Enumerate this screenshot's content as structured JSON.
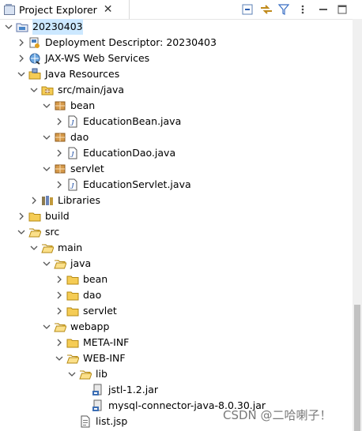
{
  "view": {
    "title": "Project Explorer",
    "close": "✕",
    "toolbar": [
      {
        "name": "collapse-all-icon"
      },
      {
        "name": "link-with-editor-icon"
      },
      {
        "name": "filter-icon"
      },
      {
        "name": "view-menu-icon"
      },
      {
        "name": "minimize-icon"
      },
      {
        "name": "maximize-icon"
      }
    ]
  },
  "tree": [
    {
      "label": "20230403",
      "depth": 0,
      "toggle": "expanded",
      "icon": "project",
      "selected": true
    },
    {
      "label": "Deployment Descriptor: 20230403",
      "depth": 1,
      "toggle": "collapsed",
      "icon": "deployment"
    },
    {
      "label": "JAX-WS Web Services",
      "depth": 1,
      "toggle": "collapsed",
      "icon": "webservice"
    },
    {
      "label": "Java Resources",
      "depth": 1,
      "toggle": "expanded",
      "icon": "jresources"
    },
    {
      "label": "src/main/java",
      "depth": 2,
      "toggle": "expanded",
      "icon": "srcfolder"
    },
    {
      "label": "bean",
      "depth": 3,
      "toggle": "expanded",
      "icon": "package"
    },
    {
      "label": "EducationBean.java",
      "depth": 4,
      "toggle": "collapsed",
      "icon": "javafile"
    },
    {
      "label": "dao",
      "depth": 3,
      "toggle": "expanded",
      "icon": "package"
    },
    {
      "label": "EducationDao.java",
      "depth": 4,
      "toggle": "collapsed",
      "icon": "javafile"
    },
    {
      "label": "servlet",
      "depth": 3,
      "toggle": "expanded",
      "icon": "package"
    },
    {
      "label": "EducationServlet.java",
      "depth": 4,
      "toggle": "collapsed",
      "icon": "javafile"
    },
    {
      "label": "Libraries",
      "depth": 2,
      "toggle": "collapsed",
      "icon": "libraries"
    },
    {
      "label": "build",
      "depth": 1,
      "toggle": "collapsed",
      "icon": "folder"
    },
    {
      "label": "src",
      "depth": 1,
      "toggle": "expanded",
      "icon": "folder-open"
    },
    {
      "label": "main",
      "depth": 2,
      "toggle": "expanded",
      "icon": "folder-open"
    },
    {
      "label": "java",
      "depth": 3,
      "toggle": "expanded",
      "icon": "folder-open"
    },
    {
      "label": "bean",
      "depth": 4,
      "toggle": "collapsed",
      "icon": "folder"
    },
    {
      "label": "dao",
      "depth": 4,
      "toggle": "collapsed",
      "icon": "folder"
    },
    {
      "label": "servlet",
      "depth": 4,
      "toggle": "collapsed",
      "icon": "folder"
    },
    {
      "label": "webapp",
      "depth": 3,
      "toggle": "expanded",
      "icon": "folder-open"
    },
    {
      "label": "META-INF",
      "depth": 4,
      "toggle": "collapsed",
      "icon": "folder"
    },
    {
      "label": "WEB-INF",
      "depth": 4,
      "toggle": "expanded",
      "icon": "folder-open"
    },
    {
      "label": "lib",
      "depth": 5,
      "toggle": "expanded",
      "icon": "folder-open"
    },
    {
      "label": "jstl-1.2.jar",
      "depth": 6,
      "toggle": "none",
      "icon": "jar"
    },
    {
      "label": "mysql-connector-java-8.0.30.jar",
      "depth": 6,
      "toggle": "none",
      "icon": "jar"
    },
    {
      "label": "list.jsp",
      "depth": 5,
      "toggle": "none",
      "icon": "jsp"
    }
  ],
  "watermark": "CSDN @二哈喇子！"
}
